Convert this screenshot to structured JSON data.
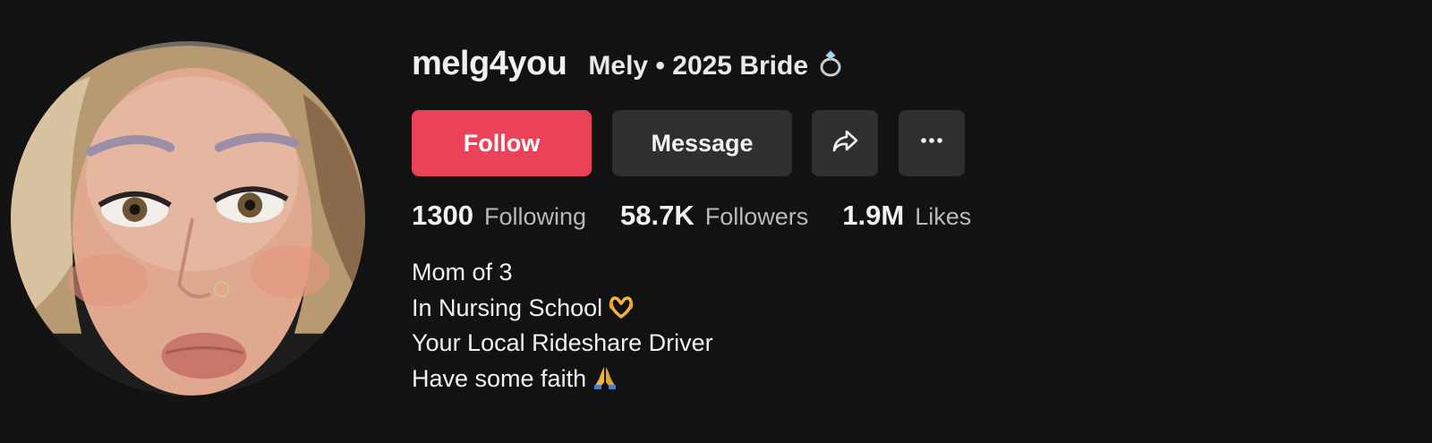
{
  "profile": {
    "username": "melg4you",
    "nickname": "Mely • 2025 Bride",
    "nickname_icon": "ring-icon"
  },
  "actions": {
    "follow_label": "Follow",
    "message_label": "Message",
    "share_icon": "share-icon",
    "more_icon": "more-icon"
  },
  "stats": [
    {
      "value": "1300",
      "label": "Following"
    },
    {
      "value": "58.7K",
      "label": "Followers"
    },
    {
      "value": "1.9M",
      "label": "Likes"
    }
  ],
  "bio": {
    "lines": [
      {
        "text": "Mom of 3",
        "emoji": ""
      },
      {
        "text": "In Nursing School",
        "emoji": "heart-hands-icon"
      },
      {
        "text": "Your Local Rideshare Driver",
        "emoji": ""
      },
      {
        "text": "Have some faith",
        "emoji": "praying-hands-icon"
      }
    ]
  },
  "colors": {
    "background": "#121212",
    "follow_button": "#ea4359",
    "secondary_button": "#2f2f2f",
    "primary_text": "#f1f1f2",
    "secondary_text": "#b9b9bc"
  }
}
